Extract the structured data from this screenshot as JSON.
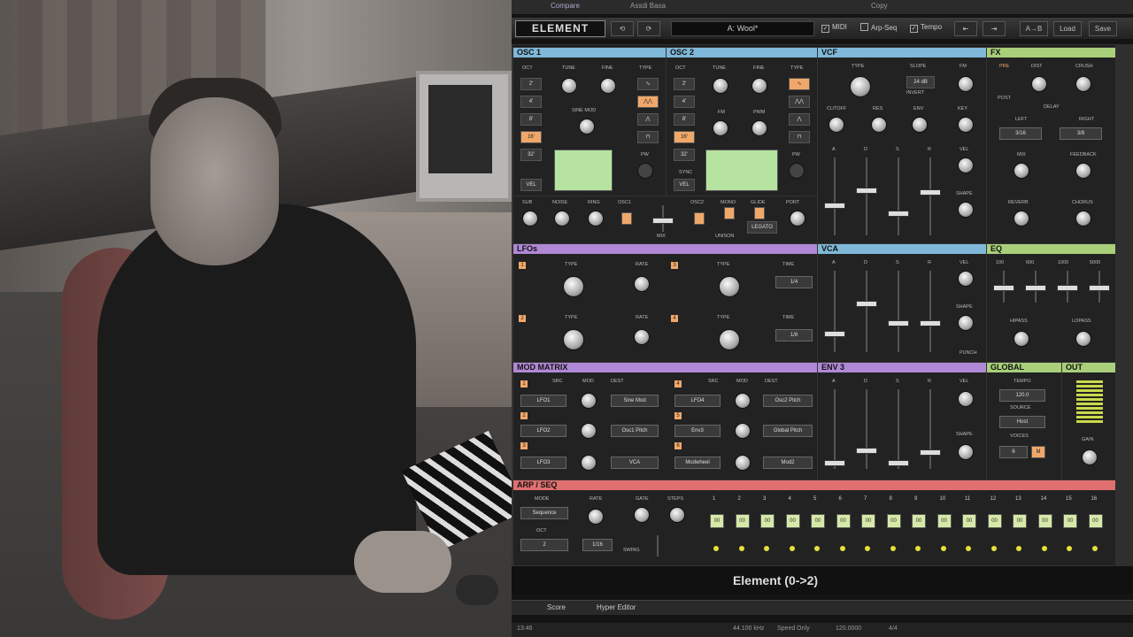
{
  "host": {
    "top_left": "",
    "top_tab_1": "Compare",
    "top_tab_2": "Assdi Basa",
    "top_copy": "Copy",
    "bottom_tabs": [
      "Score",
      "Hyper Editor"
    ],
    "bottom_values": [
      "13:46",
      "44.100 kHz",
      "Speed Only",
      "120.0000",
      "4/4"
    ]
  },
  "toolbar": {
    "logo": "ELEMENT",
    "undo": "⟲",
    "redo": "⟳",
    "preset": "A: Wool*",
    "midi": "MIDI",
    "arp_seq": "Arp-Seq",
    "tempo": "Tempo",
    "prev": "⇤",
    "next": "⇥",
    "ab": "A→B",
    "load": "Load",
    "save": "Save"
  },
  "sections": {
    "osc1": "OSC 1",
    "osc2": "OSC 2",
    "vcf": "VCF",
    "fx": "FX",
    "lfos": "LFOs",
    "vca": "VCA",
    "eq": "EQ",
    "mod_matrix": "MOD MATRIX",
    "env3": "ENV 3",
    "global": "GLOBAL",
    "out": "OUT",
    "arp_seq": "ARP / SEQ"
  },
  "osc1": {
    "labels": [
      "OCT",
      "TUNE",
      "FINE",
      "TYPE",
      "SINE MOD",
      "PW",
      "VEL"
    ],
    "oct_buttons": [
      "2'",
      "4'",
      "8'",
      "16'",
      "32'"
    ],
    "active_oct": "16'"
  },
  "osc2": {
    "labels": [
      "OCT",
      "TUNE",
      "FINE",
      "TYPE",
      "FM",
      "PWM",
      "PW",
      "SYNC",
      "VEL"
    ],
    "oct_buttons": [
      "2'",
      "4'",
      "8'",
      "16'",
      "32'"
    ],
    "active_oct": "16'"
  },
  "mixer": {
    "labels": [
      "SUB",
      "NOISE",
      "RING",
      "OSC1",
      "OSC2",
      "MONO",
      "GLIDE",
      "PORT",
      "MIX",
      "UNISON",
      "LEGATO"
    ]
  },
  "vcf": {
    "labels": [
      "TYPE",
      "SLOPE",
      "FM",
      "CUTOFF",
      "RES",
      "ENV",
      "KEY",
      "A",
      "D",
      "S",
      "R",
      "VEL",
      "SHAPE"
    ],
    "slope_value": "24 dB",
    "invert": "INVERT"
  },
  "fx": {
    "labels": [
      "PRE",
      "POST",
      "DIST",
      "CRUSH",
      "DELAY",
      "LEFT",
      "RIGHT",
      "MIX",
      "FEEDBACK",
      "REVERB",
      "CHORUS"
    ],
    "left_value": "3/16",
    "right_value": "3/8"
  },
  "lfos": {
    "labels": [
      "TYPE",
      "RATE",
      "TYPE",
      "TIME",
      "TYPE",
      "RATE",
      "TYPE",
      "TIME"
    ],
    "numbers": [
      "1",
      "2",
      "3",
      "4"
    ],
    "time_values": [
      "1/4",
      "1/8"
    ]
  },
  "vca": {
    "labels": [
      "A",
      "D",
      "S",
      "R",
      "VEL",
      "SHAPE",
      "PUNCH"
    ]
  },
  "eq": {
    "labels": [
      "100",
      "600",
      "1000",
      "5000",
      "HIPASS",
      "LOPASS"
    ]
  },
  "mod_matrix": {
    "headers": [
      "SRC",
      "MOD",
      "DEST"
    ],
    "rows": [
      {
        "num": "1",
        "src": "LFO1",
        "dest": "Sine Mod"
      },
      {
        "num": "2",
        "src": "LFO2",
        "dest": "Osc1 Pitch"
      },
      {
        "num": "3",
        "src": "LFO3",
        "dest": "VCA"
      },
      {
        "num": "4",
        "src": "LFO4",
        "dest": "Osc2 Pitch"
      },
      {
        "num": "5",
        "src": "Env3",
        "dest": "Global Pitch"
      },
      {
        "num": "6",
        "src": "Modwheel",
        "dest": "Mod2"
      }
    ]
  },
  "env3": {
    "labels": [
      "A",
      "D",
      "S",
      "R",
      "VEL",
      "SHAPE"
    ]
  },
  "global": {
    "labels": [
      "TEMPO",
      "SOURCE",
      "VOICES"
    ],
    "tempo": "120.0",
    "source": "Host",
    "voices": "6",
    "mono_badge": "M"
  },
  "out": {
    "labels": [
      "GAIN"
    ]
  },
  "arp": {
    "labels": [
      "MODE",
      "RATE",
      "GATE",
      "STEPS",
      "OCT",
      "SWING"
    ],
    "mode": "Sequence",
    "oct": "2",
    "rate": "1/16",
    "step_numbers": [
      "1",
      "2",
      "3",
      "4",
      "5",
      "6",
      "7",
      "8",
      "9",
      "10",
      "11",
      "12",
      "13",
      "14",
      "15",
      "16"
    ],
    "step_values": [
      "00",
      "00",
      "00",
      "00",
      "00",
      "00",
      "00",
      "00",
      "00",
      "00",
      "00",
      "00",
      "00",
      "00",
      "00",
      "00"
    ]
  },
  "status_title": "Element (0->2)",
  "colors": {
    "accent_orange": "#f0a86a",
    "header_blue": "#7fb8d8",
    "header_green": "#a9cf7a",
    "header_purple": "#b089d6",
    "header_red": "#e07070"
  }
}
